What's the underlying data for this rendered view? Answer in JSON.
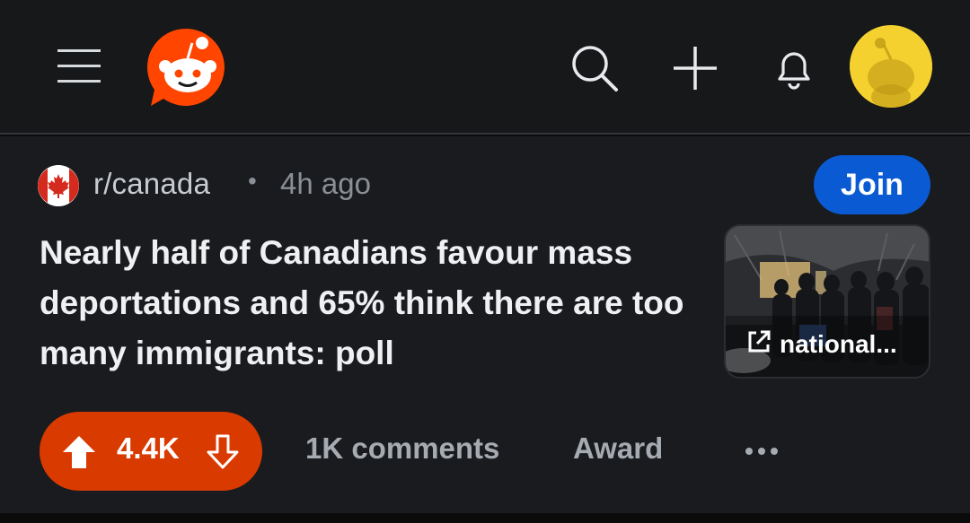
{
  "header": {
    "icons": [
      "hamburger-menu-icon",
      "reddit-logo",
      "search-icon",
      "plus-icon",
      "bell-icon",
      "avatar"
    ]
  },
  "post": {
    "subreddit": "r/canada",
    "separator": "•",
    "age": "4h ago",
    "join_label": "Join",
    "title": "Nearly half of Canadians favour mass deportations and 65% think there are too many immigrants: poll",
    "link_domain": "national...",
    "score": "4.4K",
    "comments_label": "1K comments",
    "award_label": "Award",
    "more_label": "•••"
  },
  "colors": {
    "background": "#0b0b0c",
    "header_bg": "#16181a",
    "card_bg": "#191b1e",
    "reddit_orange": "#ff4500",
    "upvoted": "#d93a00",
    "join_blue": "#0a5bd3",
    "avatar_yellow": "#f5d130"
  }
}
